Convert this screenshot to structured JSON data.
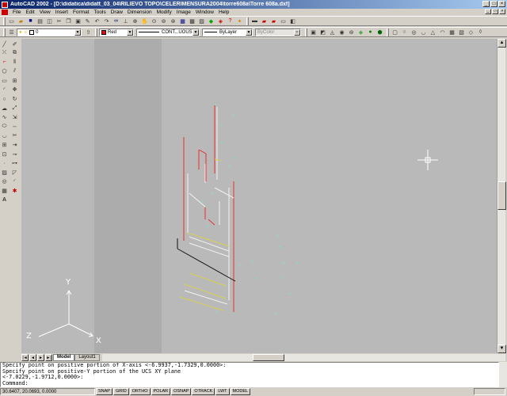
{
  "window": {
    "title": "AutoCAD 2002 - [D:\\didatica\\didatt_03_04\\RILIEVO TOPO\\CELERIMENSURA2004\\torre608a\\Torre 608a.dxf]",
    "controls": [
      "_",
      "□",
      "×"
    ]
  },
  "menu": [
    "File",
    "Edit",
    "View",
    "Insert",
    "Format",
    "Tools",
    "Draw",
    "Dimension",
    "Modify",
    "Image",
    "Window",
    "Help"
  ],
  "toolbar2": {
    "layer": "0",
    "color": "Red",
    "color_hex": "#ff0000",
    "linetype": "CONT...UOUS",
    "lineweight": "ByLayer",
    "plotstyle": "ByColor"
  },
  "ucs": {
    "x": "X",
    "y": "Y",
    "z": "Z"
  },
  "tabs": [
    "Model",
    "Layout1"
  ],
  "tab_nav": [
    "|◄",
    "◄",
    "►",
    "►|"
  ],
  "command_lines": [
    "Specify point on positive portion of X-axis <-6.9937,-1.7329,0.0000>:",
    "Specify point on positive-Y portion of the UCS XY plane",
    "<-7.0229,-1.9712,0.0000>:",
    "Command:"
  ],
  "status": {
    "coords": "30.6407, 20.0693, 0.0000",
    "toggles": [
      "SNAP",
      "GRID",
      "ORTHO",
      "POLAR",
      "OSNAP",
      "OTRACK",
      "LWT",
      "MODEL"
    ]
  }
}
